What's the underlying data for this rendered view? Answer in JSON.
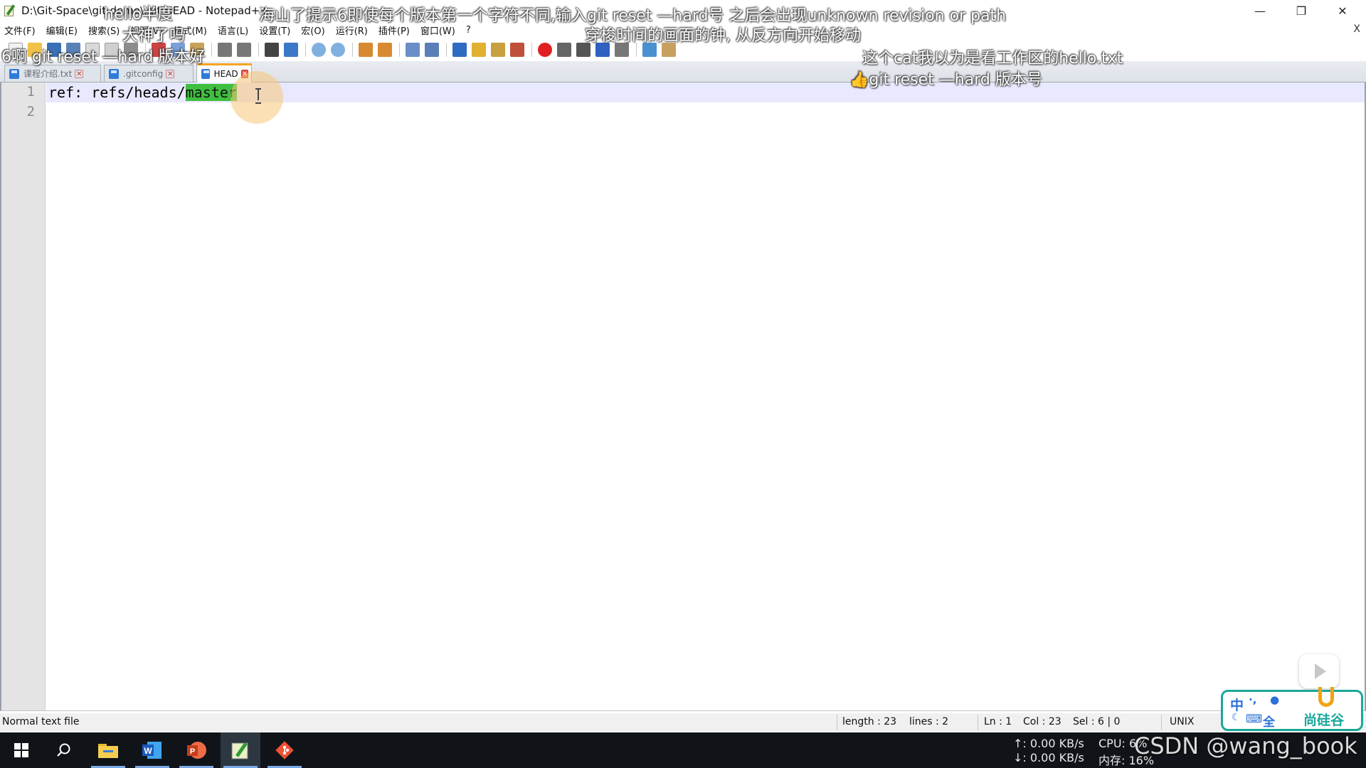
{
  "window": {
    "title": "D:\\Git-Space\\git-demo\\.git\\HEAD - Notepad++",
    "minimize": "—",
    "restore": "❐",
    "close": "✕"
  },
  "menu": {
    "items": [
      "文件(F)",
      "编辑(E)",
      "搜索(S)",
      "视图(V)",
      "格式(M)",
      "语言(L)",
      "设置(T)",
      "宏(O)",
      "运行(R)",
      "插件(P)",
      "窗口(W)",
      "?"
    ],
    "close": "X"
  },
  "toolbar": {
    "icons": [
      "new-file-icon",
      "open-file-icon",
      "save-icon",
      "save-all-icon",
      "close-icon",
      "close-all-icon",
      "print-icon",
      "cut-icon",
      "copy-icon",
      "paste-icon",
      "undo-icon",
      "redo-icon",
      "find-icon",
      "replace-icon",
      "zoom-in-icon",
      "zoom-out-icon",
      "sync-vertical-icon",
      "sync-horizontal-icon",
      "word-wrap-icon",
      "show-all-chars-icon",
      "indent-guide-icon",
      "udl-icon",
      "doc-map-icon",
      "function-list-icon",
      "record-macro-icon",
      "stop-macro-icon",
      "play-macro-icon",
      "run-macro-multiple-icon",
      "save-macro-icon",
      "launch-browser-icon",
      "doc-switcher-icon"
    ]
  },
  "tabs": [
    {
      "label": "课程介绍.txt",
      "active": false
    },
    {
      "label": ".gitconfig",
      "active": false
    },
    {
      "label": "HEAD",
      "active": true
    }
  ],
  "editor": {
    "line_numbers": [
      "1",
      "2"
    ],
    "line1_prefix": "ref: refs/heads/",
    "line1_selected": "master",
    "line2": ""
  },
  "status": {
    "file_type": "Normal text file",
    "length": "length : 23",
    "lines": "lines : 2",
    "ln": "Ln : 1",
    "col": "Col : 23",
    "sel": "Sel : 6 | 0",
    "eol": "UNIX"
  },
  "taskbar": {
    "net_up": "↑: 0.00 KB/s",
    "net_down": "↓: 0.00 KB/s",
    "cpu": "CPU: 6%",
    "mem": "内存: 16%",
    "apps": [
      "windows-start-icon",
      "search-icon",
      "file-explorer-icon",
      "word-icon",
      "powerpoint-icon",
      "notepadpp-icon",
      "git-icon"
    ]
  },
  "overlays": {
    "danmaku": [
      {
        "text": "hello半度"
      },
      {
        "text": "大神了吗"
      },
      {
        "text": "6啊 git reset —hard 版本好"
      },
      {
        "text": "海山了提示6即使每个版本第一个字符不同,输入git reset —hard号 之后会出现unknown revision or path"
      },
      {
        "text": "穿梭时间的画面的钟, 从反方向开始移动"
      },
      {
        "text": "这个cat我以为是看工作区的hello.txt"
      },
      {
        "text": "👍git reset —hard 版本号"
      }
    ],
    "ime": {
      "lang": "中",
      "punct": "·,",
      "full": "全"
    },
    "brand": "尚硅谷",
    "watermark": "CSDN @wang_book",
    "accent": "#1ba79a"
  },
  "colors": {
    "selection": "#3fbf3f",
    "current_line": "#e8e8ff",
    "active_tab_top": "#f5a623",
    "taskbar": "#101419"
  }
}
